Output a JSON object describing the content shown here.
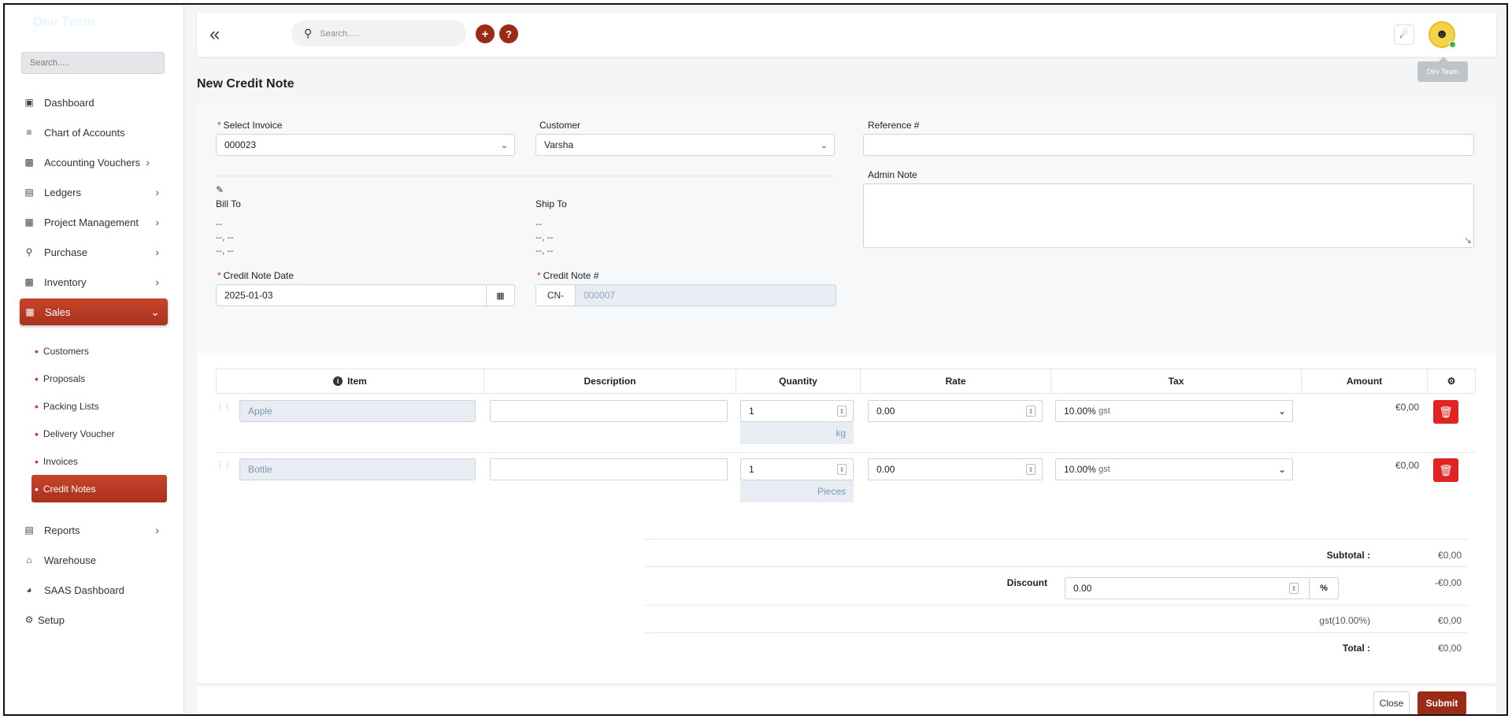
{
  "app": {
    "brand": "Dev Team"
  },
  "sidebar": {
    "search_placeholder": "Search.....",
    "items": [
      {
        "label": "Dashboard",
        "icon": "dashboard-icon"
      },
      {
        "label": "Chart of Accounts",
        "icon": "list-icon"
      },
      {
        "label": "Accounting Vouchers",
        "icon": "voucher-icon"
      },
      {
        "label": "Ledgers",
        "icon": "ledger-icon"
      },
      {
        "label": "Project Management",
        "icon": "project-icon"
      },
      {
        "label": "Purchase",
        "icon": "cart-icon"
      },
      {
        "label": "Inventory",
        "icon": "boxes-icon"
      },
      {
        "label": "Sales",
        "icon": "sales-icon"
      },
      {
        "label": "Reports",
        "icon": "reports-icon"
      },
      {
        "label": "Warehouse",
        "icon": "home-icon"
      },
      {
        "label": "SAAS Dashboard",
        "icon": "gauge-icon"
      },
      {
        "label": "Setup",
        "icon": "cogs-icon"
      }
    ],
    "sales_sub": [
      "Customers",
      "Proposals",
      "Packing Lists",
      "Delivery Voucher",
      "Invoices",
      "Credit Notes"
    ]
  },
  "topbar": {
    "search_placeholder": "Search.....",
    "tooltip": "Dev Team"
  },
  "page": {
    "title": "New Credit Note"
  },
  "form": {
    "select_invoice_label": "Select Invoice",
    "select_invoice_value": "000023",
    "customer_label": "Customer",
    "customer_value": "Varsha",
    "reference_label": "Reference #",
    "reference_value": "",
    "admin_note_label": "Admin Note",
    "bill_to_label": "Bill To",
    "bill_to_lines": [
      "--",
      "--, --",
      "--, --"
    ],
    "ship_to_label": "Ship To",
    "ship_to_lines": [
      "--",
      "--, --",
      "--, --"
    ],
    "credit_note_date_label": "Credit Note Date",
    "credit_note_date_value": "2025-01-03",
    "credit_note_no_label": "Credit Note #",
    "credit_note_prefix": "CN-",
    "credit_note_no_value": "000007"
  },
  "table": {
    "headers": [
      "Item",
      "Description",
      "Quantity",
      "Rate",
      "Tax",
      "Amount"
    ],
    "rows": [
      {
        "item": "Apple",
        "description": "",
        "quantity": "1",
        "unit": "kg",
        "rate": "0.00",
        "tax_rate": "10.00%",
        "tax_name": "gst",
        "amount": "€0,00"
      },
      {
        "item": "Bottle",
        "description": "",
        "quantity": "1",
        "unit": "Pieces",
        "rate": "0.00",
        "tax_rate": "10.00%",
        "tax_name": "gst",
        "amount": "€0,00"
      }
    ]
  },
  "totals": {
    "subtotal_label": "Subtotal :",
    "subtotal_value": "€0,00",
    "discount_label": "Discount",
    "discount_input": "0.00",
    "discount_type": "%",
    "discount_value": "-€0,00",
    "tax_label": "gst(10.00%)",
    "tax_value": "€0,00",
    "total_label": "Total :",
    "total_value": "€0,00"
  },
  "actions": {
    "close_label": "Close",
    "submit_label": "Submit"
  }
}
